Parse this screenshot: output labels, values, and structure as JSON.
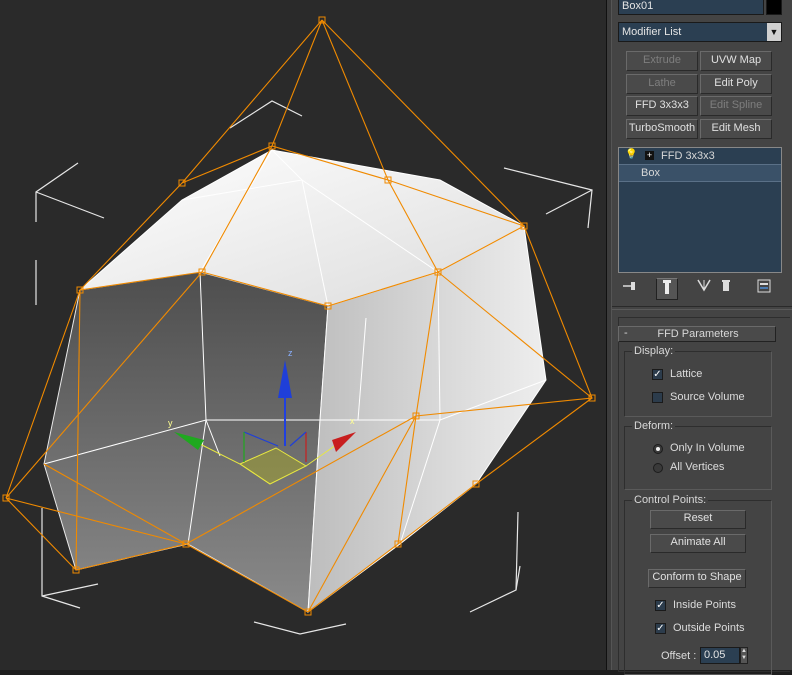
{
  "object_name": "Box01",
  "modifier_list": {
    "label": "Modifier List",
    "arrow": "▼"
  },
  "modifier_buttons": [
    {
      "label": "Extrude",
      "enabled": false
    },
    {
      "label": "UVW Map",
      "enabled": true
    },
    {
      "label": "Lathe",
      "enabled": false
    },
    {
      "label": "Edit Poly",
      "enabled": true
    },
    {
      "label": "FFD 3x3x3",
      "enabled": true
    },
    {
      "label": "Edit Spline",
      "enabled": false
    },
    {
      "label": "TurboSmooth",
      "enabled": true
    },
    {
      "label": "Edit Mesh",
      "enabled": true
    }
  ],
  "stack": {
    "items": [
      {
        "label": "FFD 3x3x3",
        "expand": "+",
        "bulb": "💡"
      },
      {
        "label": "Box"
      }
    ]
  },
  "stack_tools": {
    "pin": "pin-stack-icon",
    "show_end": "show-end-result-icon",
    "make_unique": "make-unique-icon",
    "remove": "remove-modifier-icon",
    "configure": "configure-modifier-sets-icon"
  },
  "rollout": {
    "collapse": "-",
    "title": "FFD Parameters",
    "display": {
      "label": "Display:",
      "lattice": {
        "label": "Lattice",
        "checked": true
      },
      "source_volume": {
        "label": "Source Volume",
        "checked": false
      }
    },
    "deform": {
      "label": "Deform:",
      "only_in_volume": {
        "label": "Only In Volume",
        "selected": true
      },
      "all_vertices": {
        "label": "All Vertices",
        "selected": false
      }
    },
    "control_points": {
      "label": "Control Points:",
      "reset": "Reset",
      "animate_all": "Animate All",
      "conform": "Conform to Shape",
      "inside_points": {
        "label": "Inside Points",
        "checked": true
      },
      "outside_points": {
        "label": "Outside Points",
        "checked": true
      },
      "offset_label": "Offset :",
      "offset_value": "0.05"
    }
  },
  "gizmo": {
    "x_label": "x",
    "y_label": "y",
    "z_label": "z"
  },
  "colors": {
    "lattice": "#f08a00",
    "viewport_bg": "#2a2a2a",
    "panel_bg": "#444444",
    "field_bg": "#2b3f52",
    "x_axis": "#c81e1e",
    "y_axis": "#1fa81f",
    "z_axis": "#1f3fd8"
  }
}
